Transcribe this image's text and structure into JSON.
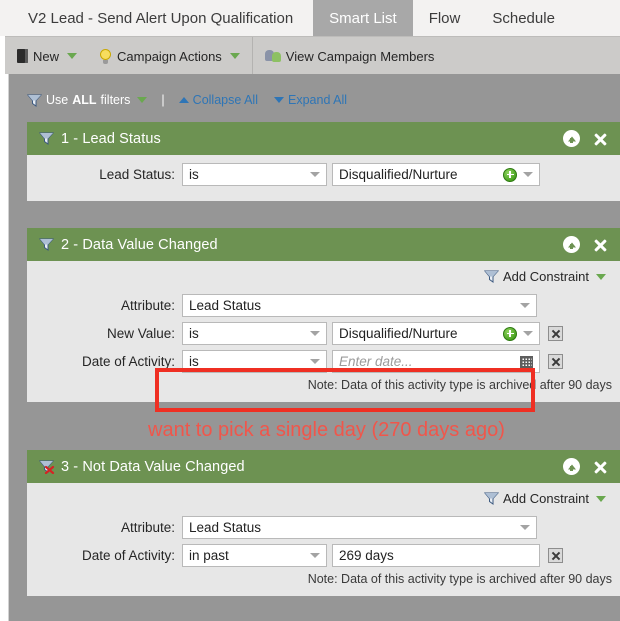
{
  "tabs": [
    {
      "label": "V2 Lead - Send Alert Upon Qualification",
      "active": false,
      "kind": "title"
    },
    {
      "label": "Smart List",
      "active": true,
      "kind": "tab"
    },
    {
      "label": "Flow",
      "active": false,
      "kind": "tab"
    },
    {
      "label": "Schedule",
      "active": false,
      "kind": "tab"
    }
  ],
  "toolbar": {
    "new_label": "New",
    "campaign_actions_label": "Campaign Actions",
    "view_members_label": "View Campaign Members"
  },
  "filterbar": {
    "use_prefix": "Use ",
    "use_strong": "ALL",
    "use_suffix": " filters",
    "pipe": "|",
    "collapse_all": "Collapse All",
    "expand_all": "Expand All"
  },
  "filters": [
    {
      "title": "1 - Lead Status",
      "icon": "funnel-icon",
      "rows": [
        {
          "label": "Lead Status:",
          "operator": "is",
          "value": "Disqualified/Nurture",
          "has_plus": true,
          "has_value_caret": true,
          "has_delete": false
        }
      ]
    },
    {
      "title": "2 - Data Value Changed",
      "icon": "funnel-icon",
      "add_constraint": "Add Constraint",
      "rows": [
        {
          "label": "Attribute:",
          "attribute": "Lead Status",
          "kind": "attribute"
        },
        {
          "label": "New Value:",
          "operator": "is",
          "value": "Disqualified/Nurture",
          "has_plus": true,
          "has_value_caret": true,
          "has_delete": true
        },
        {
          "label": "Date of Activity:",
          "operator": "is",
          "value": "",
          "placeholder": "Enter date...",
          "has_calendar": true,
          "has_delete": true
        }
      ],
      "note": "Note: Data of this activity type is archived after 90 days"
    },
    {
      "title": "3 - Not Data Value Changed",
      "icon": "funnel-not-icon",
      "add_constraint": "Add Constraint",
      "rows": [
        {
          "label": "Attribute:",
          "attribute": "Lead Status",
          "kind": "attribute"
        },
        {
          "label": "Date of Activity:",
          "operator": "in past",
          "value": "269 days",
          "has_delete": true
        }
      ],
      "note": "Note: Data of this activity type is archived after 90 days"
    }
  ],
  "annotation": {
    "text": "want to pick a single day (270 days ago)",
    "color": "#f0564b"
  },
  "colors": {
    "filter_header_green": "#6d9252",
    "panel_gray": "#969696",
    "toolbar_gray": "#cccbc9",
    "active_tab_gray": "#a8a8a8",
    "link_blue": "#2e75b6",
    "annotation_red": "#ef2f23"
  }
}
